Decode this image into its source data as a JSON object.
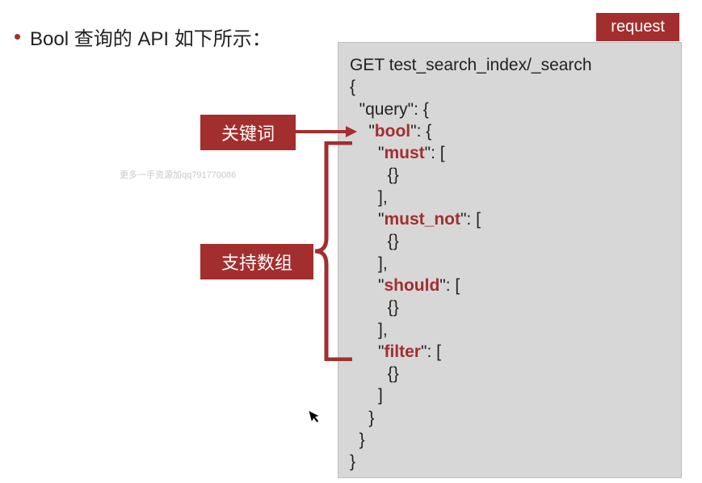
{
  "bullet": "Bool 查询的 API 如下所示：",
  "badge": "request",
  "labels": {
    "keyword": "关键词",
    "array": "支持数组"
  },
  "watermark": "更多一手资源加qq791770086",
  "code": {
    "line1": "GET test_search_index/_search",
    "kw_bool": "bool",
    "kw_must": "must",
    "kw_must_not": "must_not",
    "kw_should": "should",
    "kw_filter": "filter"
  }
}
